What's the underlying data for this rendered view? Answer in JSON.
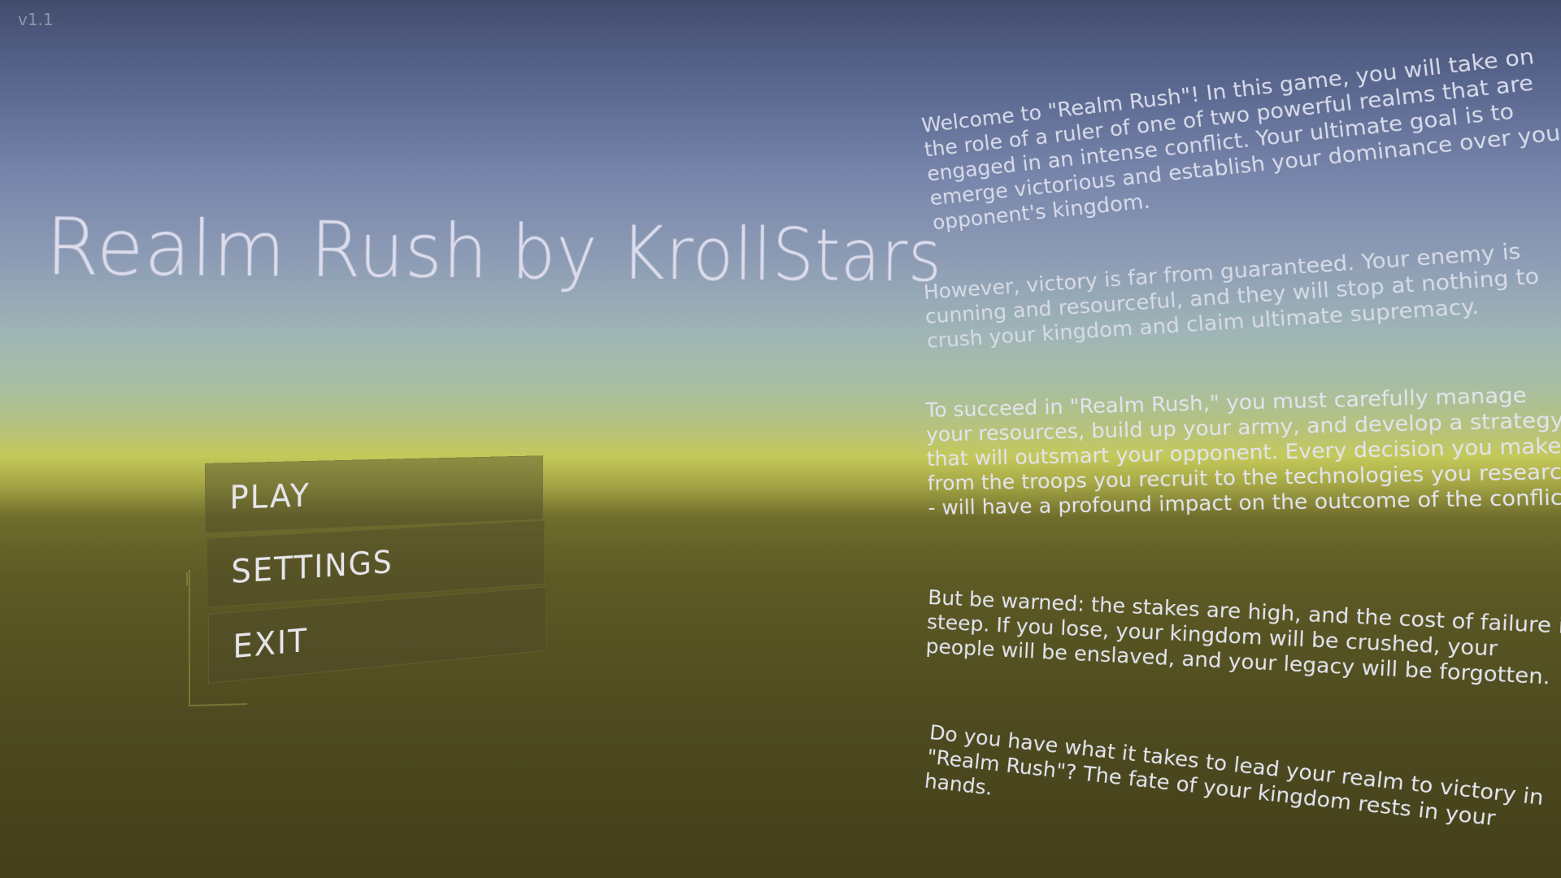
{
  "version": "v1.1",
  "title": "Realm Rush by KrollStars",
  "menu": {
    "play_label": "PLAY",
    "settings_label": "SETTINGS",
    "exit_label": "EXIT"
  },
  "description": [
    "Welcome to \"Realm Rush\"! In this game, you will take on the role of a ruler of one of two powerful realms that are engaged in an intense conflict. Your ultimate goal is to emerge victorious and establish your dominance over your opponent's kingdom.",
    "However, victory is far from guaranteed. Your enemy is cunning and resourceful, and they will stop at nothing to crush your kingdom and claim ultimate supremacy.",
    "To succeed in \"Realm Rush,\" you must carefully manage your resources, build up your army, and develop a strategy that will outsmart your opponent. Every decision you make - from the troops you recruit to the technologies you research - will have a profound impact on the outcome of the conflict.",
    "But be warned: the stakes are high, and the cost of failure is steep. If you lose, your kingdom will be crushed, your people will be enslaved, and your legacy will be forgotten.",
    "Do you have what it takes to lead your realm to victory in \"Realm Rush\"? The fate of your kingdom rests in your hands."
  ],
  "colors": {
    "sky_top": "#434c6e",
    "horizon": "#c4c95a",
    "ground": "#4f4c20",
    "text": "#e2e4ee"
  }
}
